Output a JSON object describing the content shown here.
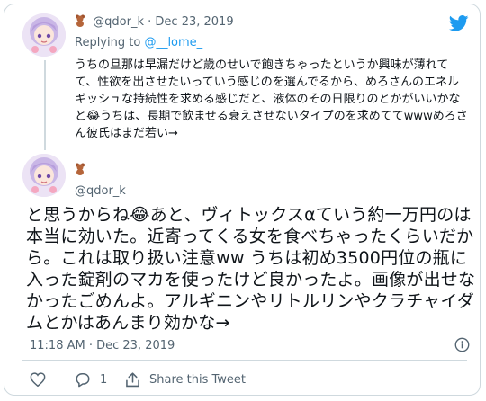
{
  "tweet_parent": {
    "handle": "@qdor_k",
    "separator": "·",
    "date": "Dec 23, 2019",
    "replying_prefix": "Replying to",
    "replying_to": "@__lome_",
    "text": "うちの旦那は早漏だけど歳のせいで飽きちゃったというか興味が薄れてて、性欲を出させたいっていう感じのを選んでるから、めろさんのエネルギッシュな持続性を求める感じだと、液体のその日限りのとかがいいかなと😂うちは、長期で飲ませる衰えさせないタイプのを求めててwwwめろさん彼氏はまだ若い→"
  },
  "tweet_main": {
    "handle": "@qdor_k",
    "text": "と思うからね😂あと、ヴィトックスαていう約一万円のは本当に効いた。近寄ってくる女を食べちゃったくらいだから。これは取り扱い注意ww うちは初め3500円位の瓶に入った錠剤のマカを使ったけど良かったよ。画像が出せなかったごめんよ。アルギニンやリトルリンやクラチャイダムとかはあんまり効かな→",
    "timestamp": "11:18 AM · Dec 23, 2019"
  },
  "actions": {
    "reply_count": "1",
    "share_label": "Share this Tweet"
  },
  "colors": {
    "accent": "#1d9bf0",
    "secondary_text": "#536471",
    "border": "#cfd9de"
  }
}
